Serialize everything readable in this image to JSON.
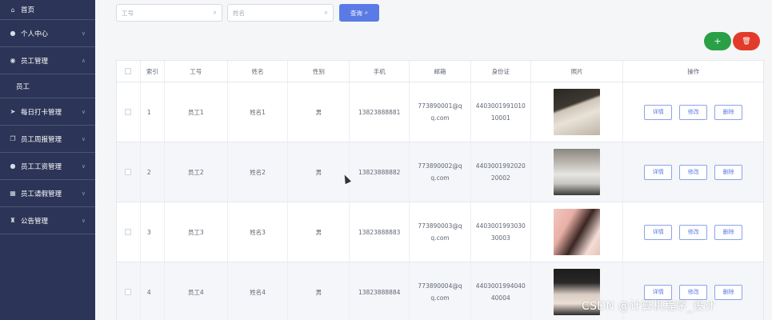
{
  "sidebar": {
    "home": {
      "label": "首页",
      "icon": "home-icon"
    },
    "items": [
      {
        "label": "个人中心",
        "icon": "user-icon"
      },
      {
        "label": "员工管理",
        "icon": "location-icon",
        "expanded": true,
        "children": [
          {
            "label": "员工"
          }
        ]
      },
      {
        "label": "每日打卡管理",
        "icon": "send-icon"
      },
      {
        "label": "员工周报管理",
        "icon": "copy-icon"
      },
      {
        "label": "员工工资管理",
        "icon": "user-icon"
      },
      {
        "label": "员工请假管理",
        "icon": "grid-icon"
      },
      {
        "label": "公告管理",
        "icon": "trophy-icon"
      }
    ]
  },
  "search": {
    "employee_no_placeholder": "工号",
    "name_placeholder": "姓名",
    "button_label": "查询"
  },
  "actions": {
    "add_label": "+",
    "delete_icon": "trash-icon"
  },
  "table": {
    "columns": [
      "",
      "索引",
      "工号",
      "姓名",
      "性别",
      "手机",
      "邮箱",
      "身份证",
      "照片",
      "操作"
    ],
    "rows": [
      {
        "index": "1",
        "no": "员工1",
        "name": "姓名1",
        "gender": "男",
        "phone": "13823888881",
        "email_a": "773890001@q",
        "email_b": "q.com",
        "id_a": "4403001991010",
        "id_b": "10001"
      },
      {
        "index": "2",
        "no": "员工2",
        "name": "姓名2",
        "gender": "男",
        "phone": "13823888882",
        "email_a": "773890002@q",
        "email_b": "q.com",
        "id_a": "4403001992020",
        "id_b": "20002"
      },
      {
        "index": "3",
        "no": "员工3",
        "name": "姓名3",
        "gender": "男",
        "phone": "13823888883",
        "email_a": "773890003@q",
        "email_b": "q.com",
        "id_a": "4403001993030",
        "id_b": "30003"
      },
      {
        "index": "4",
        "no": "员工4",
        "name": "姓名4",
        "gender": "男",
        "phone": "13823888884",
        "email_a": "773890004@q",
        "email_b": "q.com",
        "id_a": "4403001994040",
        "id_b": "40004"
      }
    ],
    "row_actions": {
      "detail": "详情",
      "edit": "修改",
      "delete": "删除"
    }
  },
  "watermark": "CSDN @计算机程序_设计",
  "colors": {
    "sidebar": "#2c3557",
    "primary": "#5a7be6",
    "add": "#2aa046",
    "danger": "#e23b2b"
  }
}
